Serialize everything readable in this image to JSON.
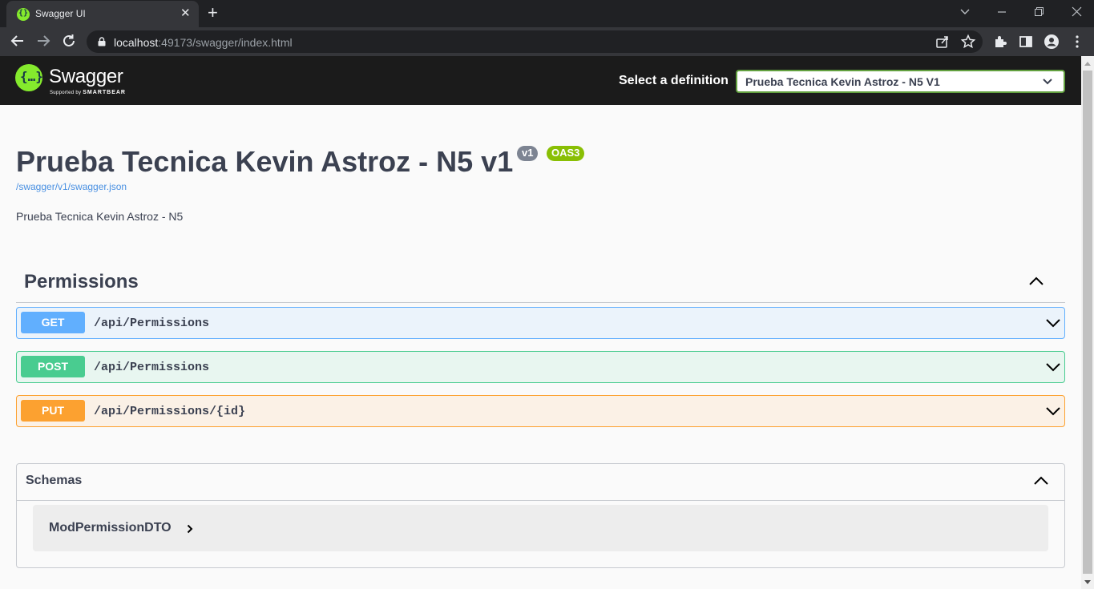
{
  "browser": {
    "tab_title": "Swagger UI",
    "tab_close": "✕",
    "new_tab": "+",
    "url_host": "localhost",
    "url_rest": ":49173/swagger/index.html"
  },
  "topbar": {
    "logo_text": "Swagger",
    "logo_supported": "Supported by",
    "logo_brand": "SMARTBEAR",
    "select_label": "Select a definition",
    "select_value": "Prueba Tecnica Kevin Astroz - N5 V1"
  },
  "info": {
    "title": "Prueba Tecnica Kevin Astroz - N5 v1",
    "version_badge": "v1",
    "oas_badge": "OAS3",
    "spec_url": "/swagger/v1/swagger.json",
    "description": "Prueba Tecnica Kevin Astroz - N5"
  },
  "tag": {
    "name": "Permissions",
    "operations": [
      {
        "method": "GET",
        "path": "/api/Permissions"
      },
      {
        "method": "POST",
        "path": "/api/Permissions"
      },
      {
        "method": "PUT",
        "path": "/api/Permissions/{id}"
      }
    ]
  },
  "schemas": {
    "title": "Schemas",
    "models": [
      {
        "name": "ModPermissionDTO"
      }
    ]
  },
  "colors": {
    "get": "#61affe",
    "post": "#49cc90",
    "put": "#fca130",
    "topbar": "#1b1b1b",
    "brand_green": "#85ea2d"
  }
}
